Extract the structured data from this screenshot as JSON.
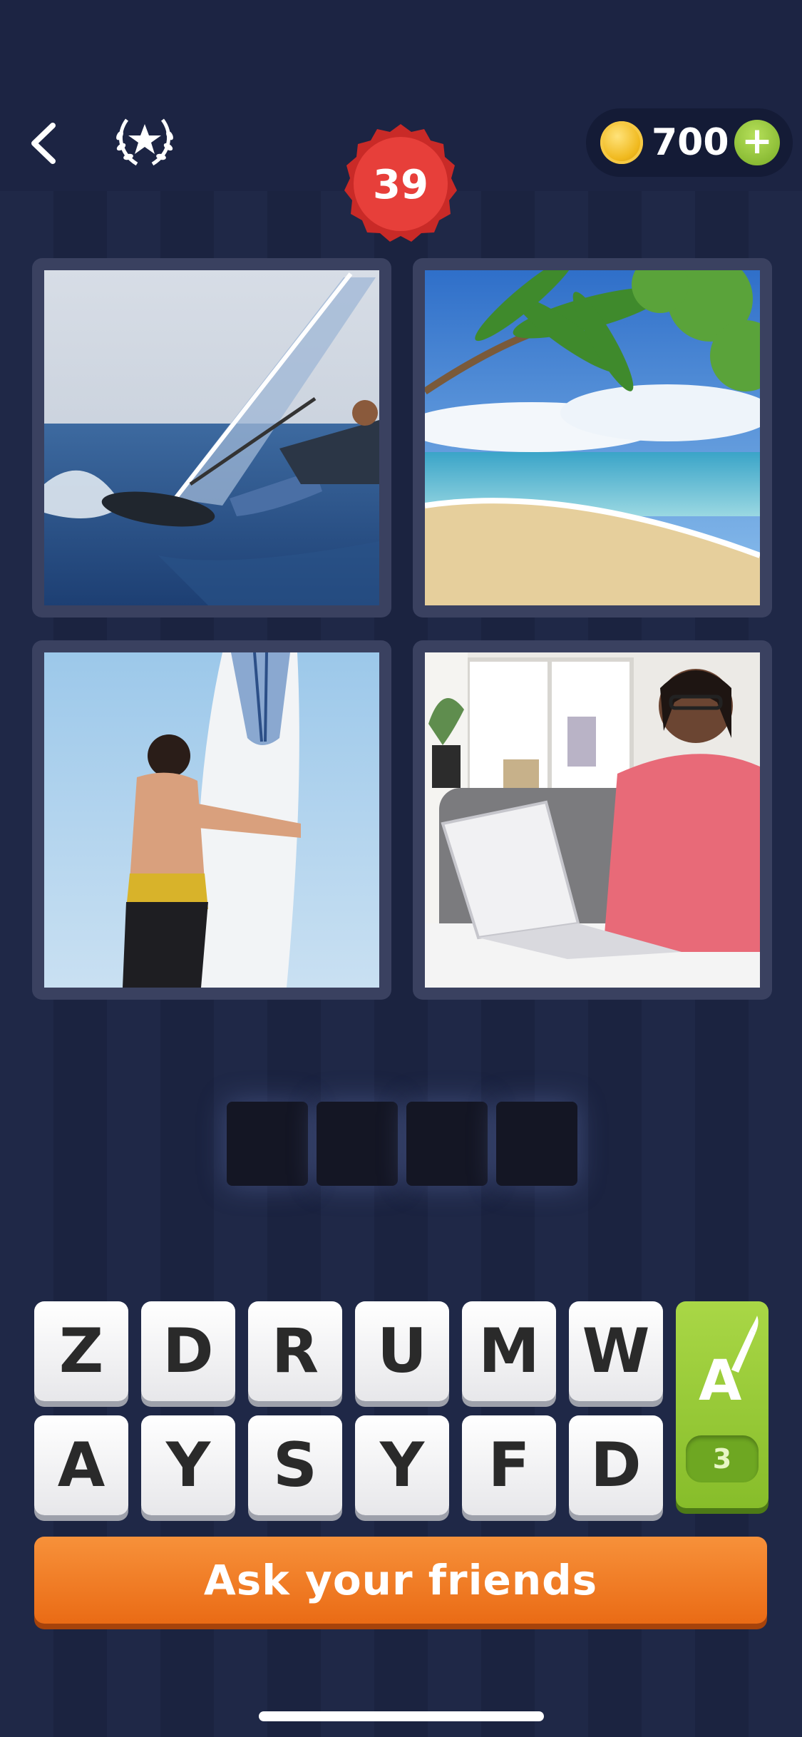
{
  "header": {
    "back_icon": "chevron-left-icon",
    "achievements_icon": "laurel-star-icon",
    "level": "39",
    "coins": "700",
    "add_coins_label": "+"
  },
  "puzzle": {
    "images": [
      {
        "subject": "windsurfer"
      },
      {
        "subject": "beach-palm"
      },
      {
        "subject": "surfboard-man"
      },
      {
        "subject": "woman-laptop"
      }
    ],
    "answer_length": 4
  },
  "keyboard": {
    "row1": [
      "Z",
      "D",
      "R",
      "U",
      "M",
      "W"
    ],
    "row2": [
      "A",
      "Y",
      "S",
      "Y",
      "F",
      "D"
    ],
    "hint_icon": "brush-letter-icon",
    "hint_count": "3"
  },
  "ask_friends_label": "Ask your friends",
  "colors": {
    "background": "#1f2847",
    "level_badge": "#e23a36",
    "hint_green": "#9ccc3b",
    "ask_orange": "#f07c22"
  }
}
